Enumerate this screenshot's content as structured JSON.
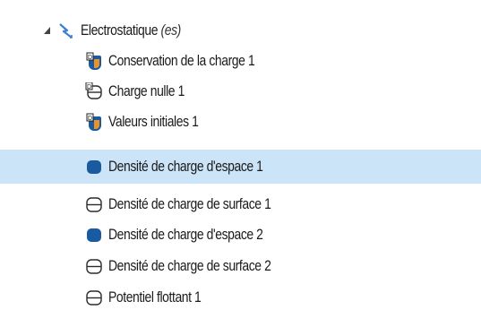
{
  "tree": {
    "root": {
      "label": "Electrostatique",
      "tag": "(es)",
      "icon": "electrostatics-physics-icon",
      "expanded": true
    },
    "items": [
      {
        "label": "Conservation de la charge 1",
        "icon": "domain-condition-default-icon"
      },
      {
        "label": "Charge nulle 1",
        "icon": "boundary-condition-default-icon"
      },
      {
        "label": "Valeurs initiales 1",
        "icon": "initial-values-icon"
      },
      {
        "label": "Densité de charge d'espace 1",
        "icon": "domain-feature-icon",
        "selected": true
      },
      {
        "label": "Densité de charge de surface 1",
        "icon": "boundary-feature-icon"
      },
      {
        "label": "Densité de charge d'espace 2",
        "icon": "domain-feature-icon"
      },
      {
        "label": "Densité de charge de surface 2",
        "icon": "boundary-feature-icon"
      },
      {
        "label": "Potentiel flottant 1",
        "icon": "boundary-feature-icon"
      }
    ],
    "colors": {
      "selection": "#cce4f7",
      "domain_fill": "#1a5aa0",
      "boundary_stroke": "#2b2b2b",
      "default_marker_orange": "#e8932a",
      "default_marker_blue": "#2a6fc4",
      "physics_icon_blue": "#3a7fd4"
    }
  }
}
